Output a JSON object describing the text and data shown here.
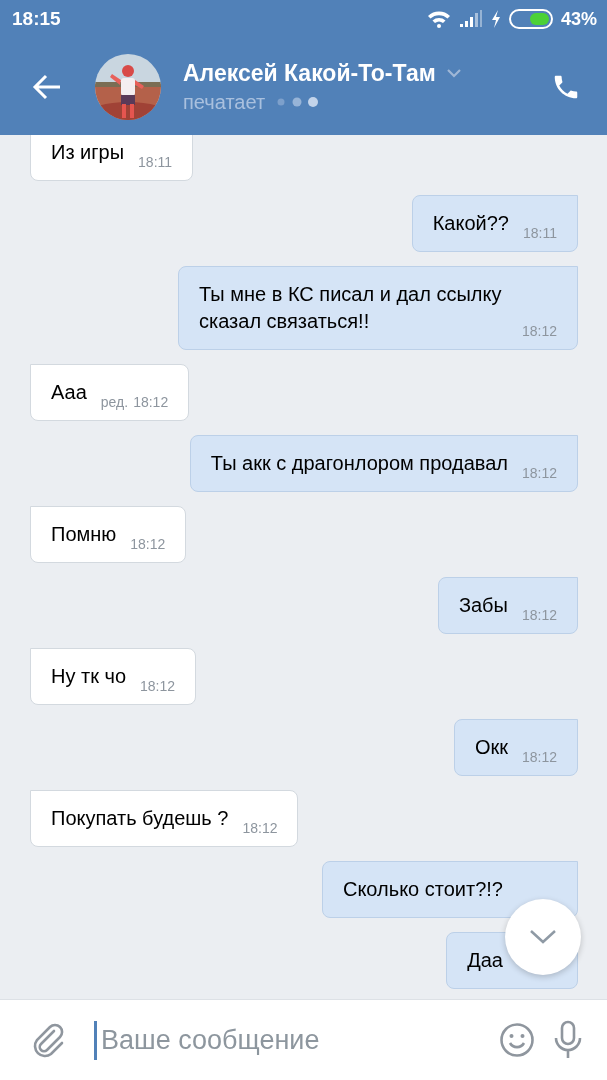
{
  "status_bar": {
    "time": "18:15",
    "battery": "43%"
  },
  "header": {
    "name": "Алексей Какой-То-Там",
    "status": "печатает"
  },
  "messages": [
    {
      "kind": "incoming",
      "text": "Из игры",
      "time": "18:11"
    },
    {
      "kind": "outgoing",
      "text": "Какой??",
      "time": "18:11"
    },
    {
      "kind": "outgoing",
      "text": "Ты мне в КС писал и дал ссылку сказал связаться!!",
      "time": "18:12"
    },
    {
      "kind": "incoming",
      "text": "Ааа",
      "edit_mark": "ред.",
      "time": "18:12"
    },
    {
      "kind": "outgoing",
      "text": "Ты акк с драгонлором продавал",
      "time": "18:12"
    },
    {
      "kind": "incoming",
      "text": "Помню",
      "time": "18:12"
    },
    {
      "kind": "outgoing",
      "text": "Забы",
      "time": "18:12"
    },
    {
      "kind": "incoming",
      "text": "Ну тк чо",
      "time": "18:12"
    },
    {
      "kind": "outgoing",
      "text": "Окк",
      "time": "18:12"
    },
    {
      "kind": "incoming",
      "text": "Покупать будешь ?",
      "time": "18:12"
    },
    {
      "kind": "outgoing",
      "text": "Сколько стоит?!?"
    },
    {
      "kind": "outgoing",
      "text": "Даа"
    }
  ],
  "composer": {
    "placeholder": "Ваше сообщение"
  }
}
